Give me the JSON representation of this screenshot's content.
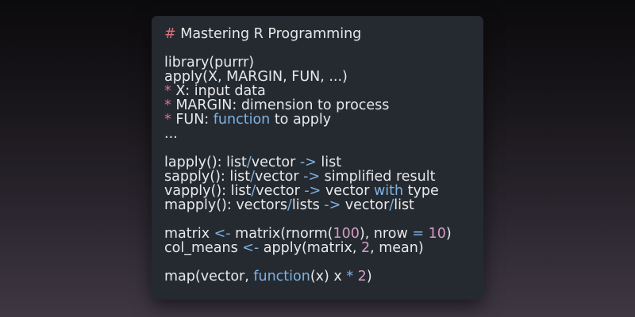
{
  "code": {
    "title_hash": "#",
    "title_text": " Mastering R Programming",
    "l_library": "library(purrr)",
    "l_apply_sig": "apply(X, MARGIN, FUN, ...)",
    "b1_star": "*",
    "b1_text": " X: input data",
    "b2_star": "*",
    "b2_text": " MARGIN: dimension to process",
    "b3_star": "*",
    "b3_text": " FUN: ",
    "b3_kw": "function",
    "b3_rest": " to apply",
    "l_ellipsis": "...",
    "lapply_a": "lapply(): list",
    "lapply_slash": "/",
    "lapply_b": "vector ",
    "lapply_arrow": "->",
    "lapply_c": " list",
    "sapply_a": "sapply(): list",
    "sapply_slash": "/",
    "sapply_b": "vector ",
    "sapply_arrow": "->",
    "sapply_c": " simplified result",
    "vapply_a": "vapply(): list",
    "vapply_slash": "/",
    "vapply_b": "vector ",
    "vapply_arrow": "->",
    "vapply_c": " vector ",
    "vapply_with": "with",
    "vapply_d": " type",
    "mapply_a": "mapply(): vectors",
    "mapply_slash": "/",
    "mapply_b": "lists ",
    "mapply_arrow": "->",
    "mapply_c": " vector",
    "mapply_slash2": "/",
    "mapply_d": "list",
    "m1_a": "matrix ",
    "m1_assign": "<-",
    "m1_b": " matrix(rnorm(",
    "m1_num1": "100",
    "m1_c": "), nrow ",
    "m1_eq": "=",
    "m1_d": " ",
    "m1_num2": "10",
    "m1_e": ")",
    "m2_a": "col_means ",
    "m2_assign": "<-",
    "m2_b": " apply(matrix, ",
    "m2_num": "2",
    "m2_c": ", mean)",
    "map_a": "map(vector, ",
    "map_kw": "function",
    "map_b": "(x) x ",
    "map_op": "*",
    "map_c": " ",
    "map_num": "2",
    "map_d": ")"
  }
}
